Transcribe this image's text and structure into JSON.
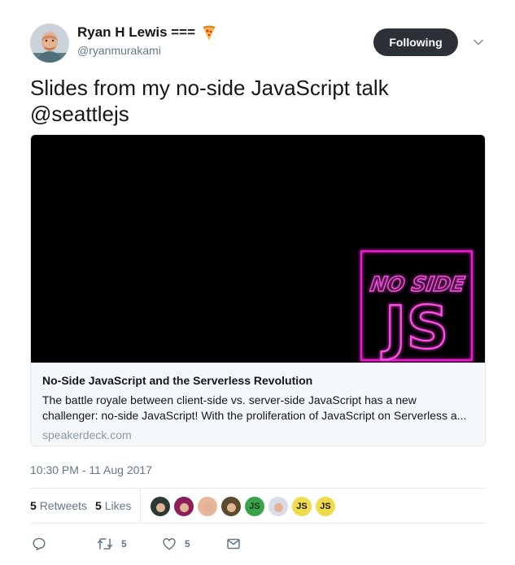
{
  "user": {
    "display_name": "Ryan H Lewis ===",
    "handle": "@ryanmurakami",
    "emoji_icon": "pizza-icon"
  },
  "header": {
    "follow_label": "Following",
    "menu_icon": "chevron-down-icon"
  },
  "tweet": {
    "text": "Slides from my no-side JavaScript talk @seattlejs",
    "timestamp": "10:30 PM - 11 Aug 2017"
  },
  "card": {
    "image_text_top": "NO SIDE",
    "image_text_bottom": "JS",
    "title": "No-Side JavaScript and the Serverless Revolution",
    "description": "The battle royale between client-side vs. server-side JavaScript has a new challenger: no-side JavaScript! With the proliferation of JavaScript on Serverless a...",
    "domain": "speakerdeck.com",
    "accent_color": "#e91fd0"
  },
  "stats": {
    "retweets_count": "5",
    "retweets_label": "Retweets",
    "likes_count": "5",
    "likes_label": "Likes"
  },
  "likers": [
    {
      "kind": "avatar",
      "bg": "#2d3a33"
    },
    {
      "kind": "avatar",
      "bg": "#8b1f5a"
    },
    {
      "kind": "avatar",
      "bg": "#e8b79a"
    },
    {
      "kind": "avatar",
      "bg": "#5b4a2e"
    },
    {
      "kind": "text",
      "label": "JS",
      "bg": "#3aa34a"
    },
    {
      "kind": "avatar",
      "bg": "#d8dde8"
    },
    {
      "kind": "text",
      "label": "JS",
      "bg": "#f0db4f"
    },
    {
      "kind": "text",
      "label": "JS",
      "bg": "#f0db4f"
    }
  ],
  "actions": {
    "reply_icon": "reply-icon",
    "retweet_icon": "retweet-icon",
    "retweet_count": "5",
    "like_icon": "heart-icon",
    "like_count": "5",
    "dm_icon": "envelope-icon"
  }
}
